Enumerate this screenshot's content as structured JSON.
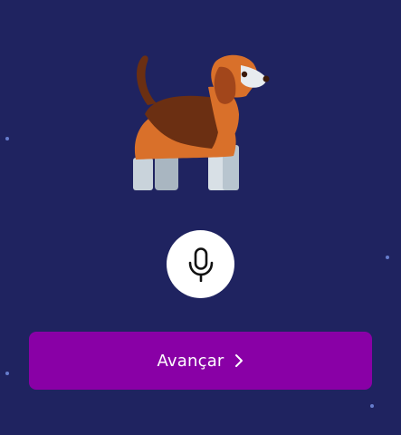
{
  "theme": {
    "background": "#1f2360",
    "button_color": "#8900a6",
    "mic_background": "#ffffff",
    "star_color": "#6e86d8"
  },
  "illustration": {
    "icon": "beagle-dog-illustration"
  },
  "mic": {
    "icon": "microphone-icon"
  },
  "next_button": {
    "label": "Avançar",
    "icon": "chevron-right-icon"
  }
}
